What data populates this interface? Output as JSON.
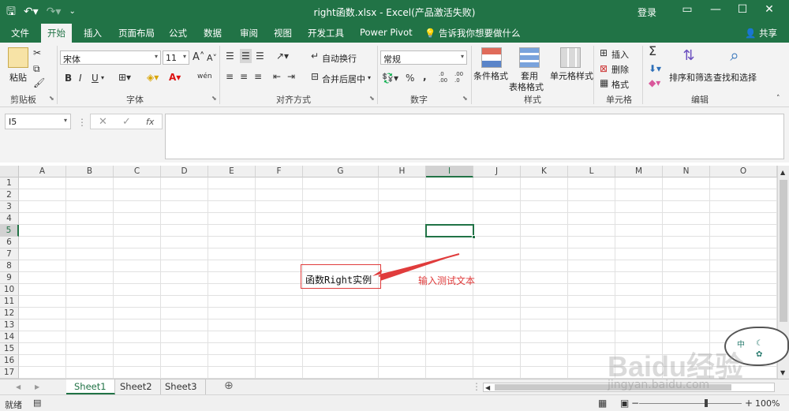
{
  "titlebar": {
    "title": "right函数.xlsx  -  Excel(产品激活失败)",
    "login": "登录",
    "qa_icons": [
      "save-icon",
      "undo-icon",
      "redo-icon",
      "customize-icon"
    ],
    "win_icons": [
      "ribbon-display-icon",
      "minimize-icon",
      "maximize-icon",
      "close-icon"
    ]
  },
  "tabs": [
    "文件",
    "开始",
    "插入",
    "页面布局",
    "公式",
    "数据",
    "审阅",
    "视图",
    "开发工具",
    "Power Pivot",
    "告诉我你想要做什么"
  ],
  "active_tab": "开始",
  "share": "共享",
  "ribbon": {
    "clipboard": {
      "label": "剪贴板",
      "paste": "粘贴"
    },
    "font": {
      "label": "字体",
      "font_name": "宋体",
      "font_size": "11",
      "bold": "B",
      "italic": "I",
      "underline": "U",
      "grow": "A",
      "shrink": "A",
      "wen": "wén",
      "color_a": "A"
    },
    "alignment": {
      "label": "对齐方式",
      "wrap": "自动换行",
      "merge": "合并后居中"
    },
    "number": {
      "label": "数字",
      "format": "常规",
      "percent": "%",
      "comma": ",",
      "inc_dec": ".0 .00",
      "dec_dec": ".00 .0"
    },
    "styles": {
      "label": "样式",
      "cond": "条件格式",
      "table1": "套用",
      "table2": "表格格式",
      "cell": "单元格样式"
    },
    "cells": {
      "label": "单元格",
      "insert": "插入",
      "delete": "删除",
      "format": "格式"
    },
    "editing": {
      "label": "编辑",
      "sigma": "Σ",
      "sort": "排序和筛选",
      "find": "查找和选择"
    }
  },
  "formula_bar": {
    "name_box": "I5",
    "fx": "fx",
    "cancel": "✕",
    "enter": "✓",
    "value": ""
  },
  "grid": {
    "columns": [
      "A",
      "B",
      "C",
      "D",
      "E",
      "F",
      "G",
      "H",
      "I",
      "J",
      "K",
      "L",
      "M",
      "N",
      "O"
    ],
    "rows": [
      "1",
      "2",
      "3",
      "4",
      "5",
      "6",
      "7",
      "8",
      "9",
      "10",
      "11",
      "12",
      "13",
      "14",
      "15",
      "16",
      "17"
    ],
    "selected_col": "I",
    "selected_row": "5",
    "cell_text": "函数Right实例",
    "annotation": "输入测试文本"
  },
  "sheets": [
    "Sheet1",
    "Sheet2",
    "Sheet3"
  ],
  "active_sheet": "Sheet1",
  "status": {
    "ready": "就绪",
    "zoom": "100%"
  },
  "watermark": {
    "text": "Baidu经验",
    "sub": "jingyan.baidu.com",
    "bubble1": "中",
    "bubble2": "☾",
    "bubble3": "✿"
  },
  "colors": {
    "excel_green": "#217346",
    "annotation_red": "#e03c3c"
  }
}
